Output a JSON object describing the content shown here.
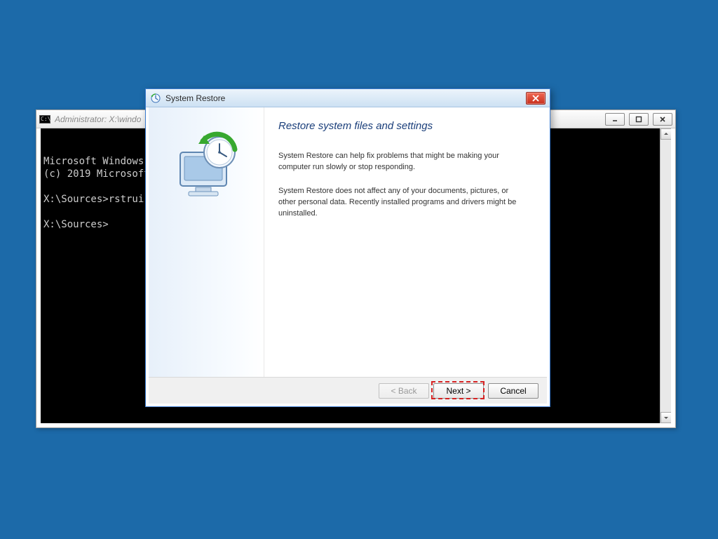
{
  "desktop": {
    "bg": "#1c6aa9"
  },
  "cmd": {
    "title": "Administrator: X:\\windo",
    "lines": {
      "l1": "Microsoft Windows  ",
      "l2": "(c) 2019 Microsoft ",
      "l3": "",
      "l4": "X:\\Sources>rstrui.e",
      "l5": "",
      "l6": "X:\\Sources>"
    },
    "controls": {
      "minimize": "minimize",
      "maximize": "maximize",
      "close": "close"
    }
  },
  "wizard": {
    "title": "System Restore",
    "heading": "Restore system files and settings",
    "para1": "System Restore can help fix problems that might be making your computer run slowly or stop responding.",
    "para2": "System Restore does not affect any of your documents, pictures, or other personal data. Recently installed programs and drivers might be uninstalled.",
    "buttons": {
      "back": "< Back",
      "next": "Next >",
      "cancel": "Cancel"
    },
    "close_label": "close"
  }
}
